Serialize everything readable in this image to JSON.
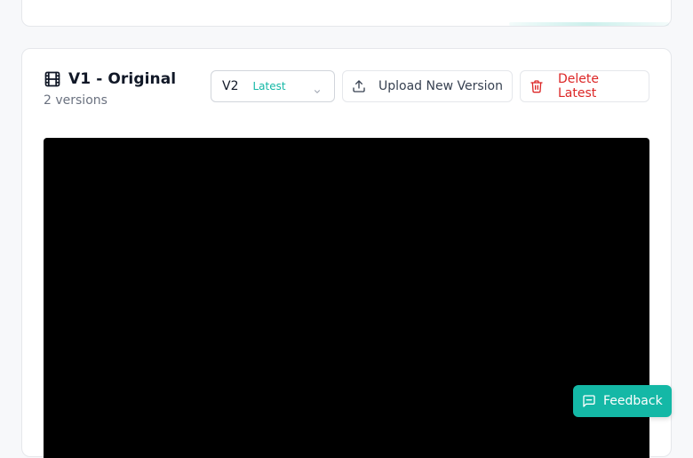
{
  "video_card": {
    "title": "V1 - Original",
    "subtitle": "2 versions",
    "version_select": {
      "value": "V2",
      "badge": "Latest"
    },
    "upload_button": {
      "label": "Upload New Version",
      "icon": "upload-icon"
    },
    "delete_button": {
      "label": "Delete Latest",
      "icon": "trash-icon"
    },
    "title_icon": "film-icon"
  },
  "feedback_button": {
    "label": "Feedback",
    "icon": "message-square-icon"
  },
  "colors": {
    "accent": "#14b8a6",
    "danger": "#dc2626",
    "video_bg": "#000000"
  }
}
